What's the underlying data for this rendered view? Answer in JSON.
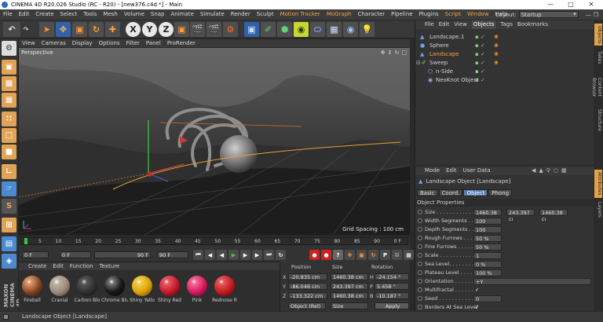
{
  "titlebar": {
    "title": "CINEMA 4D R20.026 Studio (RC - R20) - [new376.c4d *] - Main"
  },
  "menu": [
    "File",
    "Edit",
    "Create",
    "Select",
    "Tools",
    "Mesh",
    "Volume",
    "Snap",
    "Animate",
    "Simulate",
    "Render",
    "Sculpt",
    "Motion Tracker",
    "MoGraph",
    "Character",
    "Pipeline",
    "Plugins",
    "Script",
    "Window",
    "Help"
  ],
  "layout": {
    "label": "Layout:",
    "value": "Startup"
  },
  "toolbar": {
    "axis_x": "X",
    "axis_y": "Y",
    "axis_z": "Z"
  },
  "viewport": {
    "menu": [
      "View",
      "Cameras",
      "Display",
      "Options",
      "Filter",
      "Panel",
      "ProRender"
    ],
    "camera": "Perspective",
    "grid_spacing": "Grid Spacing : 100 cm"
  },
  "timeline": {
    "ticks": [
      "0",
      "5",
      "10",
      "15",
      "20",
      "25",
      "30",
      "35",
      "40",
      "45",
      "50",
      "55",
      "60",
      "65",
      "70",
      "75",
      "80",
      "85",
      "90"
    ],
    "end_tick": "0 F",
    "start_frame": "0 F",
    "current": "0 F",
    "end_a": "90 F",
    "end_b": "90 F"
  },
  "materials": {
    "menu": [
      "Create",
      "Edit",
      "Function",
      "Texture"
    ],
    "items": [
      {
        "name": "Fireball",
        "color": "#7a3a1c"
      },
      {
        "name": "Cranial",
        "color": "#9a8a7a"
      },
      {
        "name": "Carbon Blo",
        "color": "#303030"
      },
      {
        "name": "Chrome Blu",
        "color": "#1b1b1b"
      },
      {
        "name": "Shiny Yello",
        "color": "#d9a10a"
      },
      {
        "name": "Shiny Red",
        "color": "#c0192b"
      },
      {
        "name": "Pink",
        "color": "#d8185c"
      },
      {
        "name": "Rednose R",
        "color": "#c41a1f"
      }
    ]
  },
  "coords": {
    "headers": [
      "Position",
      "Size",
      "Rotation"
    ],
    "rows": [
      {
        "axis": "X",
        "pos": "-20.835 cm",
        "size": "1460.38 cm",
        "rot_axis": "H",
        "rot": "-24.154 °"
      },
      {
        "axis": "Y",
        "pos": "-86.046 cm",
        "size": "243.397 cm",
        "rot_axis": "P",
        "rot": "5.458 °"
      },
      {
        "axis": "Z",
        "pos": "-133.322 cm",
        "size": "1460.38 cm",
        "rot_axis": "B",
        "rot": "-10.187 °"
      }
    ],
    "mode": "Object (Rel)",
    "size_mode": "Size",
    "apply": "Apply"
  },
  "objects": {
    "menu": [
      "File",
      "Edit",
      "View",
      "Objects",
      "Tags",
      "Bookmarks"
    ],
    "items": [
      {
        "name": "Landscape.1",
        "indent": 0,
        "color": "#cfcfcf"
      },
      {
        "name": "Sphere",
        "indent": 0,
        "color": "#cfcfcf"
      },
      {
        "name": "Landscape",
        "indent": 0,
        "color": "#f2a43a"
      },
      {
        "name": "Sweep",
        "indent": 0,
        "color": "#cfcfcf"
      },
      {
        "name": "n-Side",
        "indent": 1,
        "color": "#cfcfcf"
      },
      {
        "name": "NeoKnot Object",
        "indent": 1,
        "color": "#cfcfcf"
      }
    ]
  },
  "attributes": {
    "menu": [
      "Mode",
      "Edit",
      "User Data"
    ],
    "title": "Landscape Object [Landscape]",
    "tabs": [
      "Basic",
      "Coord.",
      "Object",
      "Phong"
    ],
    "active_tab": "Object",
    "section": "Object Properties",
    "rows": [
      {
        "label": "Size . . . . . . . . . . . . . . .",
        "v1": "1460.38 cı",
        "v2": "243.397 cı",
        "v3": "1460.38 cı"
      },
      {
        "label": "Width Segments . . .",
        "v1": "100"
      },
      {
        "label": "Depth Segments . . .",
        "v1": "100"
      },
      {
        "label": "Rough Furrows . . . .",
        "v1": "50 %"
      },
      {
        "label": "Fine Furrows . . . . .",
        "v1": "50 %"
      },
      {
        "label": "Scale . . . . . . . . . . .",
        "v1": "1"
      },
      {
        "label": "Sea Level. . . . . . . .",
        "v1": "0 %"
      },
      {
        "label": "Plateau Level . . . . .",
        "v1": "100 %"
      },
      {
        "label": "Orientation . . . . . .",
        "v1": "+Y"
      },
      {
        "label": "Multifractal . . . . . .",
        "v1": "✓"
      },
      {
        "label": "Seed . . . . . . . . . . . .",
        "v1": "0"
      },
      {
        "label": "Borders At Sea Level",
        "v1": "✓"
      },
      {
        "label": "Spherical. . . . . . . . .",
        "v1": ""
      }
    ]
  },
  "right_tabs": [
    "Objects",
    "Takes",
    "Content Browser",
    "Structure",
    "Attributes",
    "Layers"
  ],
  "status": "Landscape Object [Landscape]"
}
